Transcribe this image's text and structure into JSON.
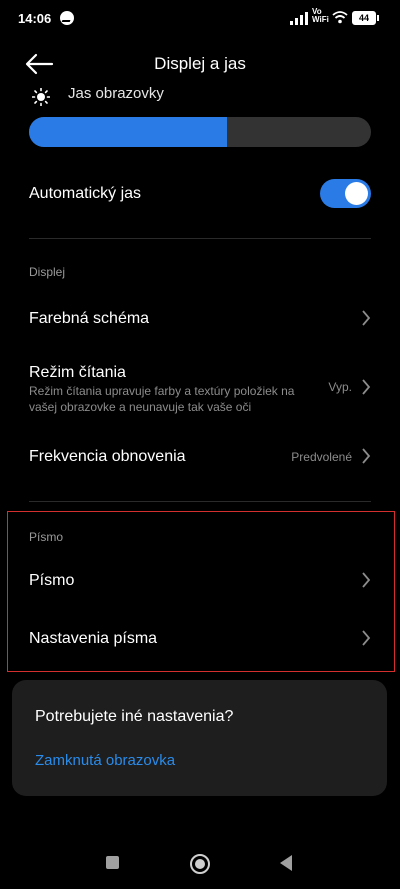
{
  "status_bar": {
    "time": "14:06",
    "vo": "Vo",
    "wifi_label": "WiFi",
    "battery": "44"
  },
  "header": {
    "title": "Displej a jas"
  },
  "brightness": {
    "label": "Jas obrazovky",
    "level": 0.58
  },
  "auto_brightness": {
    "label": "Automatický jas",
    "enabled": true
  },
  "display_section": {
    "title": "Displej",
    "items": [
      {
        "label": "Farebná schéma",
        "value": ""
      },
      {
        "label": "Režim čítania",
        "description_line1": "Režim čítania upravuje farby a textúry položiek na",
        "description_line2": "vašej obrazovke a neunavuje tak vaše oči",
        "value": "Vyp."
      },
      {
        "label": "Frekvencia obnovenia",
        "value": "Predvolené"
      }
    ]
  },
  "font_section": {
    "title": "Písmo",
    "items": [
      {
        "label": "Písmo"
      },
      {
        "label": "Nastavenia písma"
      }
    ]
  },
  "card": {
    "question": "Potrebujete iné nastavenia?",
    "link": "Zamknutá obrazovka"
  },
  "colors": {
    "accent": "#2a7be6",
    "link": "#2a8bea",
    "highlight_box": "#d32f2f"
  }
}
